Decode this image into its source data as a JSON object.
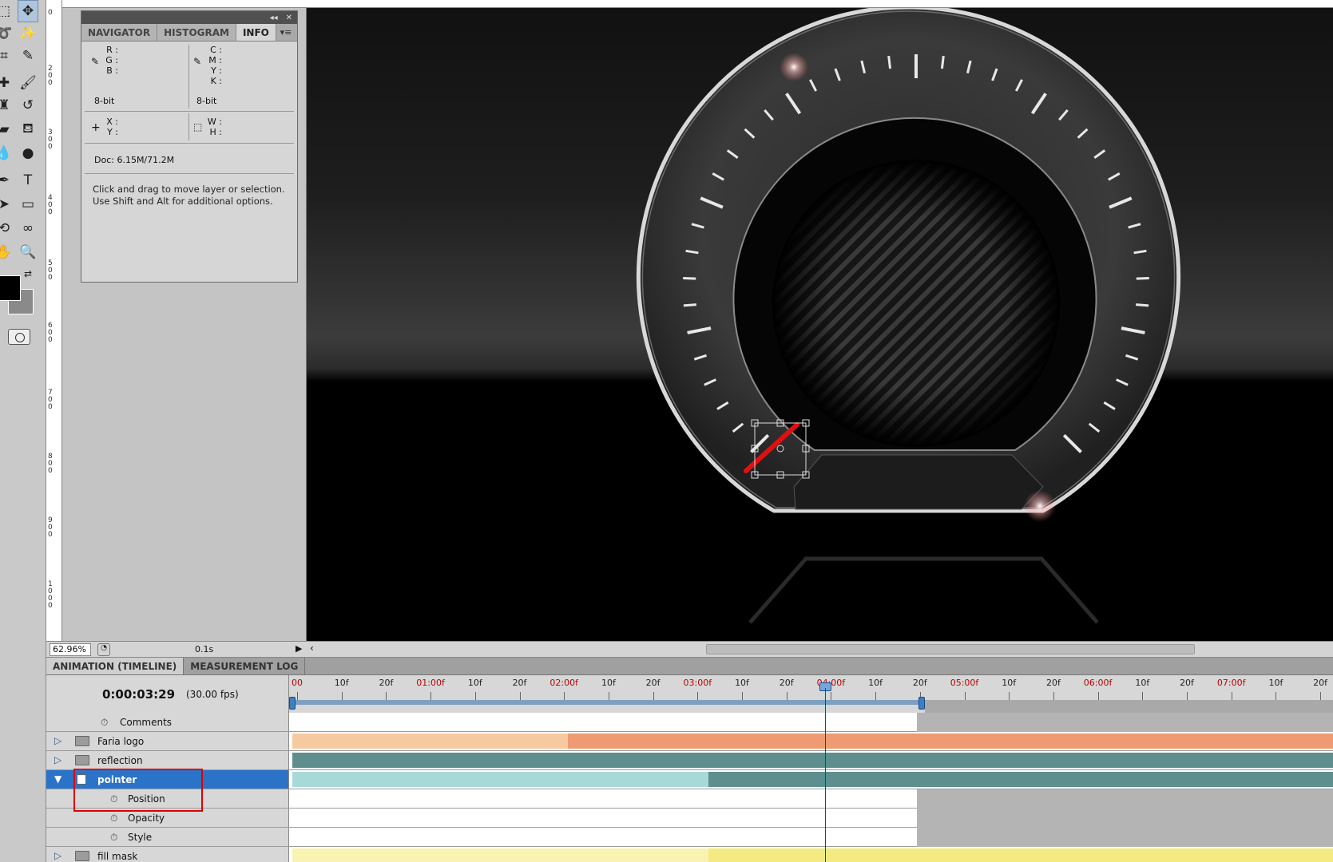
{
  "info_panel": {
    "tabs": [
      "NAVIGATOR",
      "HISTOGRAM",
      "INFO"
    ],
    "active_tab": "INFO",
    "rgb_labels": [
      "R :",
      "G :",
      "B :"
    ],
    "cmyk_labels": [
      "C :",
      "M :",
      "Y :",
      "K :"
    ],
    "bit_depth_left": "8-bit",
    "bit_depth_right": "8-bit",
    "xy_labels": [
      "X :",
      "Y :"
    ],
    "wh_labels": [
      "W :",
      "H :"
    ],
    "doc_size": "Doc: 6.15M/71.2M",
    "hint": "Click and drag to move layer or selection.  Use Shift and Alt for additional options."
  },
  "status_bar": {
    "zoom": "62.96%",
    "frame_delay": "0.1s"
  },
  "animation_panel": {
    "tabs": [
      "ANIMATION (TIMELINE)",
      "MEASUREMENT LOG"
    ],
    "active_tab": "ANIMATION (TIMELINE)",
    "current_time": "0:00:03:29",
    "fps": "(30.00 fps)",
    "ruler_labels": [
      "00",
      "10f",
      "20f",
      "01:00f",
      "10f",
      "20f",
      "02:00f",
      "10f",
      "20f",
      "03:00f",
      "10f",
      "20f",
      "04:00f",
      "10f",
      "20f",
      "05:00f",
      "10f",
      "20f",
      "06:00f",
      "10f",
      "20f",
      "07:00f",
      "10f",
      "20f"
    ],
    "work_area_end_fraction": 0.6,
    "layers": [
      {
        "name": "Comments",
        "kind": "property",
        "bar_color": "#ffffff",
        "bar_color_2": "#ffffff"
      },
      {
        "name": "Faria logo",
        "kind": "group",
        "bar_color": "#f7c9a0",
        "bar_color_2": "#ee9a72"
      },
      {
        "name": "reflection",
        "kind": "group",
        "bar_color": "#5f8e8e",
        "bar_color_2": "#5f8e8e"
      },
      {
        "name": "pointer",
        "kind": "layer",
        "selected": true,
        "bar_color": "#a7d9d9",
        "bar_color_2": "#5f8e8e"
      },
      {
        "name": "Position",
        "kind": "property",
        "bar_color": "#ffffff",
        "bar_color_2": "#ffffff"
      },
      {
        "name": "Opacity",
        "kind": "property",
        "bar_color": "#ffffff",
        "bar_color_2": "#ffffff"
      },
      {
        "name": "Style",
        "kind": "property",
        "bar_color": "#ffffff",
        "bar_color_2": "#ffffff"
      },
      {
        "name": "fill mask",
        "kind": "group",
        "bar_color": "#f8f3b0",
        "bar_color_2": "#f3ea82"
      }
    ]
  },
  "toolbar": {
    "tools": [
      "move-tool",
      "magic-wand-tool",
      "lasso-tool",
      "crop-tool",
      "eyedropper-tool",
      "healing-brush-tool",
      "brush-tool",
      "clone-stamp-tool",
      "history-brush-tool",
      "eraser-tool",
      "paint-bucket-tool",
      "blur-tool",
      "dodge-tool",
      "pen-tool",
      "type-tool",
      "path-selection-tool",
      "shape-tool",
      "3d-rotate-tool",
      "3d-orbit-tool",
      "hand-tool",
      "zoom-tool"
    ],
    "foreground_color": "#000000",
    "background_color": "#8a8a8a"
  },
  "colors": {
    "selection_blue": "#2b73c9",
    "playhead_red": "#d00000",
    "highlight_red": "#e00000",
    "pointer_red": "#e01010"
  }
}
